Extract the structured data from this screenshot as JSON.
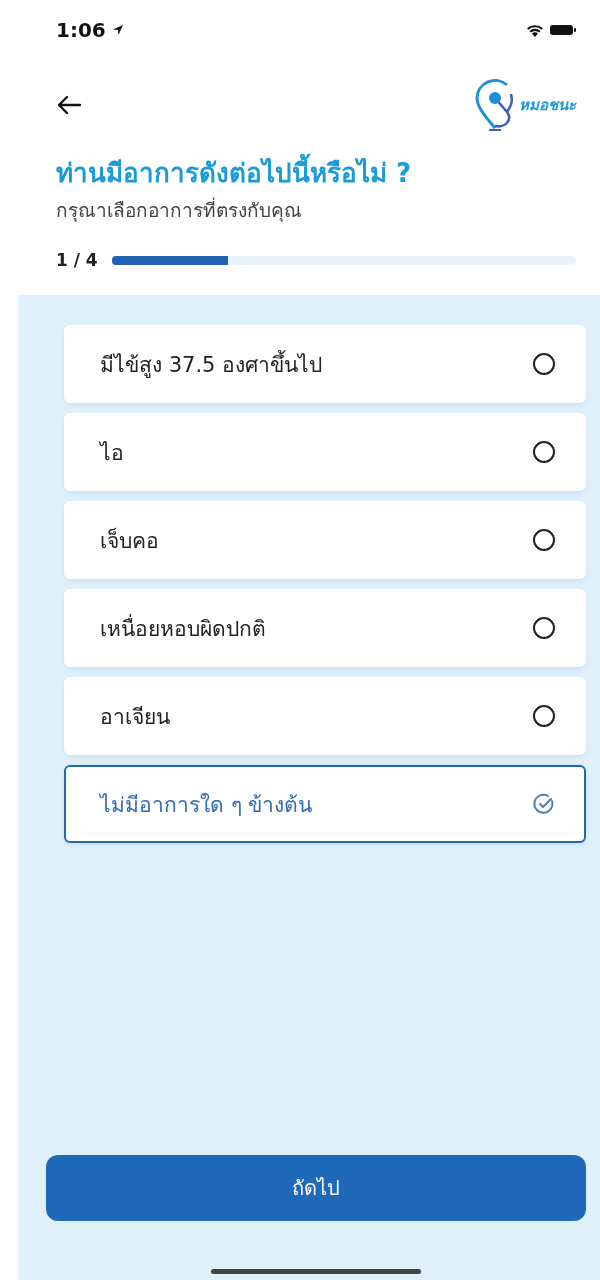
{
  "status_bar": {
    "time": "1:06"
  },
  "header": {
    "logo_text": "หมอชนะ"
  },
  "title": "ท่านมีอาการดังต่อไปนี้หรือไม่ ?",
  "subtitle": "กรุณาเลือกอาการที่ตรงกับคุณ",
  "progress": {
    "label": "1 / 4",
    "level": 0.25
  },
  "options": [
    {
      "label": "มีไข้สูง 37.5 องศาขึ้นไป",
      "selected": false
    },
    {
      "label": "ไอ",
      "selected": false
    },
    {
      "label": "เจ็บคอ",
      "selected": false
    },
    {
      "label": "เหนื่อยหอบผิดปกติ",
      "selected": false
    },
    {
      "label": "อาเจียน",
      "selected": false
    },
    {
      "label": "ไม่มีอาการใด ๆ ข้างต้น",
      "selected": true
    }
  ],
  "next_button": "ถัดไป"
}
